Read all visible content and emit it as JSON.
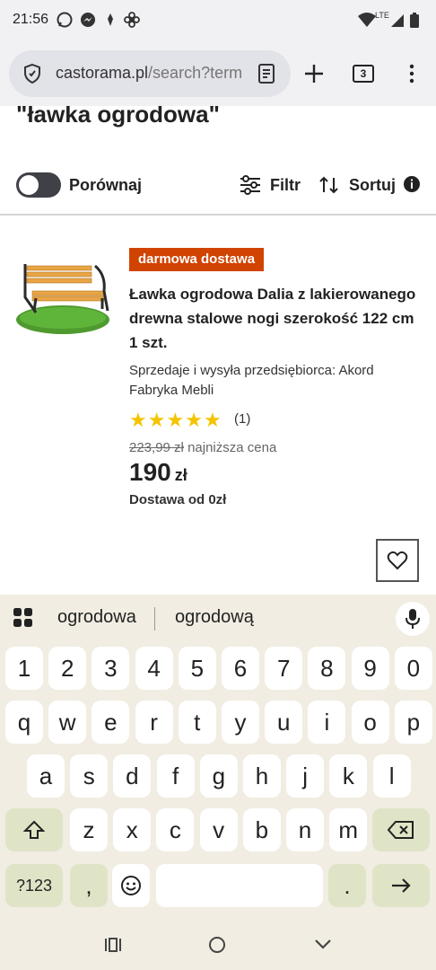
{
  "status": {
    "time": "21:56",
    "network": "LTE"
  },
  "browser": {
    "url_main": "castorama.pl",
    "url_rest": "/search?term",
    "tab_count": "3"
  },
  "page": {
    "heading": "\"ławka ogrodowa\"",
    "compare_label": "Porównaj",
    "filter_label": "Filtr",
    "sort_label": "Sortuj"
  },
  "product": {
    "badge": "darmowa dostawa",
    "title": "Ławka ogrodowa Dalia z lakierowanego drewna stalowe nogi szerokość 122 cm 1 szt.",
    "seller": "Sprzedaje i wysyła przedsiębiorca: Akord Fabryka Mebli",
    "rating": 5,
    "rating_count": "(1)",
    "old_price": "223,99 zł",
    "old_price_note": "najniższa cena",
    "price": "190",
    "currency": "zł",
    "delivery": "Dostawa od 0zł"
  },
  "keyboard": {
    "suggestions": [
      "ogrodowa",
      "ogrodową"
    ],
    "row_numbers": [
      "1",
      "2",
      "3",
      "4",
      "5",
      "6",
      "7",
      "8",
      "9",
      "0"
    ],
    "row1": [
      "q",
      "w",
      "e",
      "r",
      "t",
      "y",
      "u",
      "i",
      "o",
      "p"
    ],
    "row2": [
      "a",
      "s",
      "d",
      "f",
      "g",
      "h",
      "j",
      "k",
      "l"
    ],
    "row3": [
      "z",
      "x",
      "c",
      "v",
      "b",
      "n",
      "m"
    ],
    "symbols_key": "?123",
    "comma_key": ",",
    "period_key": "."
  },
  "colors": {
    "badge": "#d14300",
    "star": "#f5c400",
    "keyboard_bg": "#f1ede2",
    "func_key": "#dfe4c6"
  }
}
